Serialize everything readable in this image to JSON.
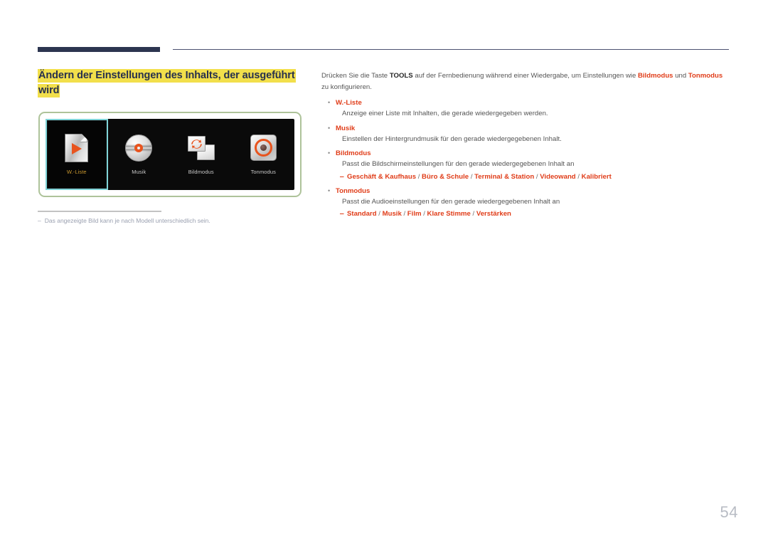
{
  "page": {
    "number": "54",
    "title": "Ändern der Einstellungen des Inhalts, der ausgeführt wird"
  },
  "colors": {
    "highlight": "#f2df4b",
    "title_text": "#27304d",
    "keyword": "#e03c18",
    "body_text": "#555555",
    "rule_navy": "#2c3550",
    "figure_border": "#aec39a",
    "selection_border": "#7fd4d8",
    "selected_label": "#c9982f",
    "icon_accent": "#e8541e",
    "page_number": "#b8bcc4"
  },
  "figure": {
    "name": "osd-tools-menu",
    "items": [
      {
        "id": "w-liste",
        "label": "W.-Liste",
        "icon": "document-play-icon",
        "selected": true
      },
      {
        "id": "musik",
        "label": "Musik",
        "icon": "cd-disc-icon",
        "selected": false
      },
      {
        "id": "bildmodus",
        "label": "Bildmodus",
        "icon": "screens-refresh-icon",
        "selected": false
      },
      {
        "id": "tonmodus",
        "label": "Tonmodus",
        "icon": "speaker-ring-icon",
        "selected": false
      }
    ]
  },
  "footnote": {
    "marker": "‒",
    "text": "Das angezeigte Bild kann je nach Modell unterschiedlich sein."
  },
  "content": {
    "intro": {
      "part1": "Drücken Sie die Taste ",
      "bold1": "TOOLS",
      "part2": " auf der Fernbedienung während einer Wiedergabe, um Einstellungen wie ",
      "kw1": "Bildmodus",
      "part3": " und ",
      "kw2": "Tonmodus",
      "part4": " zu konfigurieren."
    },
    "bullet_marker": "•",
    "sub_marker": "‒",
    "bullets": [
      {
        "term": "W.-Liste",
        "desc": "Anzeige einer Liste mit Inhalten, die gerade wiedergegeben werden.",
        "options": ""
      },
      {
        "term": "Musik",
        "desc": "Einstellen der Hintergrundmusik für den gerade wiedergegebenen Inhalt.",
        "options": ""
      },
      {
        "term": "Bildmodus",
        "desc": "Passt die Bildschirmeinstellungen für den gerade wiedergegebenen Inhalt an",
        "options": "Geschäft & Kaufhaus / Büro & Schule / Terminal & Station / Videowand / Kalibriert"
      },
      {
        "term": "Tonmodus",
        "desc": "Passt die Audioeinstellungen für den gerade wiedergegebenen Inhalt an",
        "options": "Standard / Musik / Film / Klare Stimme / Verstärken"
      }
    ]
  }
}
